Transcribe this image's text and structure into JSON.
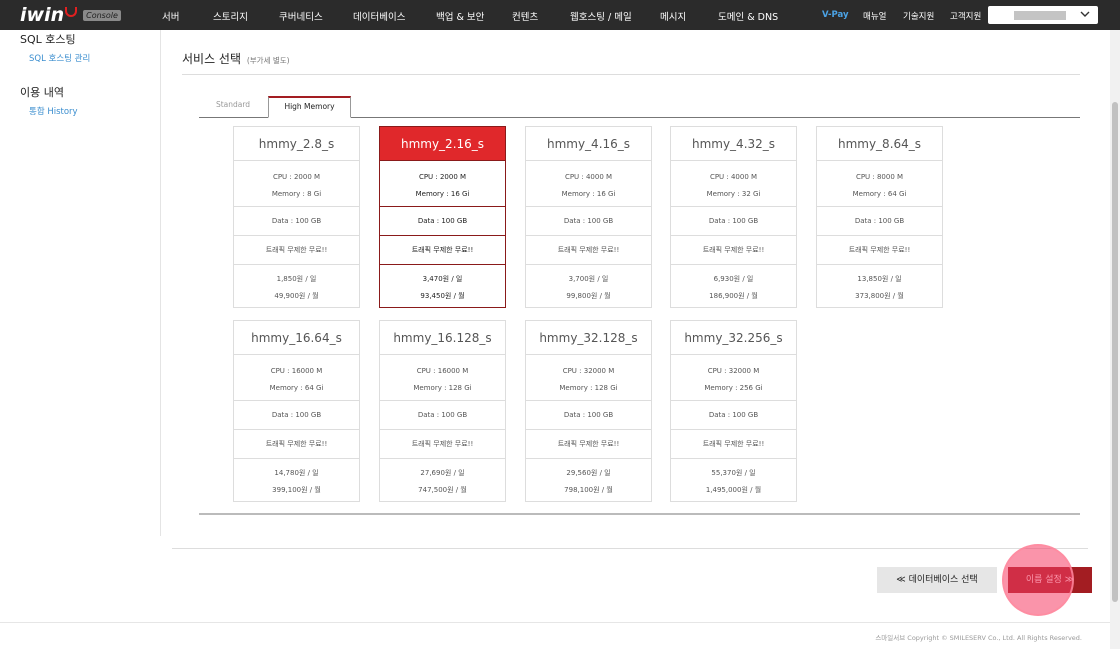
{
  "header": {
    "logo_text": "iwin",
    "logo_badge": "Console",
    "nav": [
      "서버",
      "스토리지",
      "쿠버네티스",
      "데이터베이스",
      "백업 & 보안",
      "컨텐츠",
      "웹호스팅 / 메일",
      "메시지",
      "도메인 & DNS"
    ],
    "vpay": "V-Pay",
    "util": [
      "매뉴얼",
      "기술지원",
      "고객지원"
    ]
  },
  "sidebar": {
    "headings": [
      "SQL 호스팅",
      "이용 내역"
    ],
    "links": [
      "SQL 호스팅 관리",
      "통합 History"
    ]
  },
  "section": {
    "title": "서비스 선택",
    "sub": "(부가세 별도)"
  },
  "tabs": {
    "standard": "Standard",
    "high_memory": "High Memory"
  },
  "cards": [
    {
      "name": "hmmy_2.8_s",
      "cpu": "CPU : 2000 M",
      "memory": "Memory : 8 Gi",
      "data": "Data : 100 GB",
      "traffic": "트래픽 무제한 무료!!",
      "daily": "1,850원 / 일",
      "monthly": "49,900원 / 월"
    },
    {
      "name": "hmmy_2.16_s",
      "cpu": "CPU : 2000 M",
      "memory": "Memory : 16 Gi",
      "data": "Data : 100 GB",
      "traffic": "트래픽 무제한 무료!!",
      "daily": "3,470원 / 일",
      "monthly": "93,450원 / 월"
    },
    {
      "name": "hmmy_4.16_s",
      "cpu": "CPU : 4000 M",
      "memory": "Memory : 16 Gi",
      "data": "Data : 100 GB",
      "traffic": "트래픽 무제한 무료!!",
      "daily": "3,700원 / 일",
      "monthly": "99,800원 / 월"
    },
    {
      "name": "hmmy_4.32_s",
      "cpu": "CPU : 4000 M",
      "memory": "Memory : 32 Gi",
      "data": "Data : 100 GB",
      "traffic": "트래픽 무제한 무료!!",
      "daily": "6,930원 / 일",
      "monthly": "186,900원 / 월"
    },
    {
      "name": "hmmy_8.64_s",
      "cpu": "CPU : 8000 M",
      "memory": "Memory : 64 Gi",
      "data": "Data : 100 GB",
      "traffic": "트래픽 무제한 무료!!",
      "daily": "13,850원 / 일",
      "monthly": "373,800원 / 월"
    },
    {
      "name": "hmmy_16.64_s",
      "cpu": "CPU : 16000 M",
      "memory": "Memory : 64 Gi",
      "data": "Data : 100 GB",
      "traffic": "트래픽 무제한 무료!!",
      "daily": "14,780원 / 일",
      "monthly": "399,100원 / 월"
    },
    {
      "name": "hmmy_16.128_s",
      "cpu": "CPU : 16000 M",
      "memory": "Memory : 128 Gi",
      "data": "Data : 100 GB",
      "traffic": "트래픽 무제한 무료!!",
      "daily": "27,690원 / 일",
      "monthly": "747,500원 / 월"
    },
    {
      "name": "hmmy_32.128_s",
      "cpu": "CPU : 32000 M",
      "memory": "Memory : 128 Gi",
      "data": "Data : 100 GB",
      "traffic": "트래픽 무제한 무료!!",
      "daily": "29,560원 / 일",
      "monthly": "798,100원 / 월"
    },
    {
      "name": "hmmy_32.256_s",
      "cpu": "CPU : 32000 M",
      "memory": "Memory : 256 Gi",
      "data": "Data : 100 GB",
      "traffic": "트래픽 무제한 무료!!",
      "daily": "55,370원 / 일",
      "monthly": "1,495,000원 / 월"
    }
  ],
  "selected_card": "hmmy_2.16_s",
  "buttons": {
    "back": "≪ 데이터베이스 선택",
    "next": "이름 설정 ≫"
  },
  "footer": "스마일서브 Copyright © SMILESERV Co., Ltd. All Rights Reserved.",
  "colors": {
    "accent": "#a31d22",
    "selected": "#e0282b",
    "link": "#3b8ecf",
    "topbar": "#2b2b2b"
  }
}
